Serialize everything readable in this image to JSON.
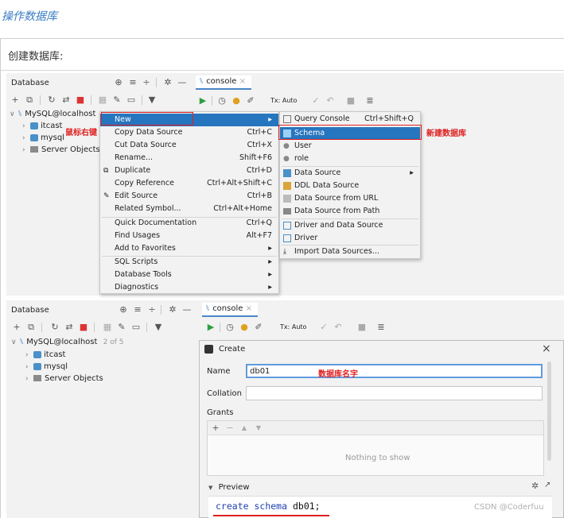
{
  "heading": "操作数据库",
  "intro": "创建数据库:",
  "panel1": {
    "title": "Database",
    "console_tab": "console",
    "tx_label": "Tx: Auto",
    "tree": {
      "root": "MySQL@localhost",
      "items": [
        "itcast",
        "mysql",
        "Server Objects"
      ]
    },
    "annot_right_click": "鼠标右键",
    "annot_new_db": "新建数据库",
    "context_menu": [
      {
        "label": "New",
        "shortcut": ""
      },
      {
        "label": "Copy Data Source",
        "shortcut": "Ctrl+C"
      },
      {
        "label": "Cut Data Source",
        "shortcut": "Ctrl+X"
      },
      {
        "label": "Rename...",
        "shortcut": "Shift+F6"
      },
      {
        "label": "Duplicate",
        "shortcut": "Ctrl+D"
      },
      {
        "label": "Copy Reference",
        "shortcut": "Ctrl+Alt+Shift+C"
      },
      {
        "label": "Edit Source",
        "shortcut": "Ctrl+B"
      },
      {
        "label": "Related Symbol...",
        "shortcut": "Ctrl+Alt+Home"
      },
      {
        "label": "Quick Documentation",
        "shortcut": "Ctrl+Q"
      },
      {
        "label": "Find Usages",
        "shortcut": "Alt+F7"
      },
      {
        "label": "Add to Favorites",
        "shortcut": ""
      },
      {
        "label": "SQL Scripts",
        "shortcut": ""
      },
      {
        "label": "Database Tools",
        "shortcut": ""
      },
      {
        "label": "Diagnostics",
        "shortcut": ""
      }
    ],
    "submenu": [
      {
        "label": "Query Console",
        "shortcut": "Ctrl+Shift+Q"
      },
      {
        "label": "Schema",
        "shortcut": ""
      },
      {
        "label": "User",
        "shortcut": ""
      },
      {
        "label": "role",
        "shortcut": ""
      },
      {
        "label": "Data Source",
        "shortcut": ""
      },
      {
        "label": "DDL Data Source",
        "shortcut": ""
      },
      {
        "label": "Data Source from URL",
        "shortcut": ""
      },
      {
        "label": "Data Source from Path",
        "shortcut": ""
      },
      {
        "label": "Driver and Data Source",
        "shortcut": ""
      },
      {
        "label": "Driver",
        "shortcut": ""
      },
      {
        "label": "Import Data Sources...",
        "shortcut": ""
      }
    ]
  },
  "panel2": {
    "title": "Database",
    "console_tab": "console",
    "tx_label": "Tx: Auto",
    "tree": {
      "root": "MySQL@localhost",
      "root_count": "2 of 5",
      "items": [
        "itcast",
        "mysql",
        "Server Objects"
      ]
    },
    "dialog": {
      "title": "Create",
      "name_label": "Name",
      "name_value": "db01",
      "annot_db_name": "数据库名字",
      "collation_label": "Collation",
      "grants_label": "Grants",
      "empty_text": "Nothing to show",
      "preview_label": "Preview",
      "sql_kw1": "create",
      "sql_kw2": "schema",
      "sql_rest": "db01;"
    }
  },
  "watermark": "CSDN @Coderfuu",
  "colors": {
    "accent": "#2675bf",
    "annotation": "#e02020",
    "heading": "#3a7cc2"
  }
}
